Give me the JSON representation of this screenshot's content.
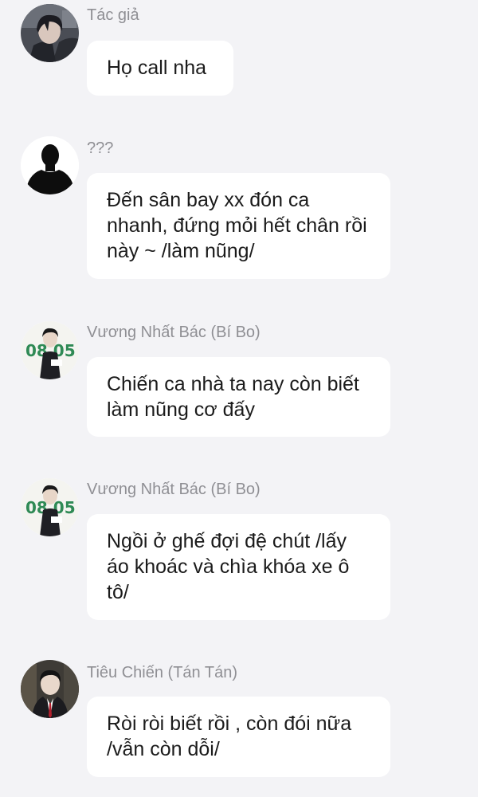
{
  "messages": [
    {
      "sender": "Tác giả",
      "text": "Họ call nha",
      "avatar": "dark-haired-boy-avatar"
    },
    {
      "sender": "???",
      "text": "Đến sân bay xx đón ca nhanh, đứng mỏi hết chân rồi này ~ /làm nũng/",
      "avatar": "unknown-silhouette-avatar"
    },
    {
      "sender": "Vương Nhất Bác (Bí Bo)",
      "text": "Chiến ca nhà ta nay còn biết làm nũng cơ đấy",
      "avatar": "birthday-0805-avatar",
      "avatar_text": "08 05"
    },
    {
      "sender": "Vương Nhất Bác (Bí Bo)",
      "text": "Ngồi ở ghế đợi đệ chút /lấy áo khoác và chìa khóa xe ô tô/",
      "avatar": "birthday-0805-avatar",
      "avatar_text": "08 05"
    },
    {
      "sender": "Tiêu Chiến (Tán Tán)",
      "text": "Ròi ròi biết rồi , còn đói nữa /vẫn còn dỗi/",
      "avatar": "suit-man-avatar"
    }
  ],
  "colors": {
    "background": "#f3f3f6",
    "bubble": "#ffffff",
    "sender_name": "#8f8f94",
    "message_text": "#1b1b1b",
    "avatar_green": "#2f8a55"
  }
}
